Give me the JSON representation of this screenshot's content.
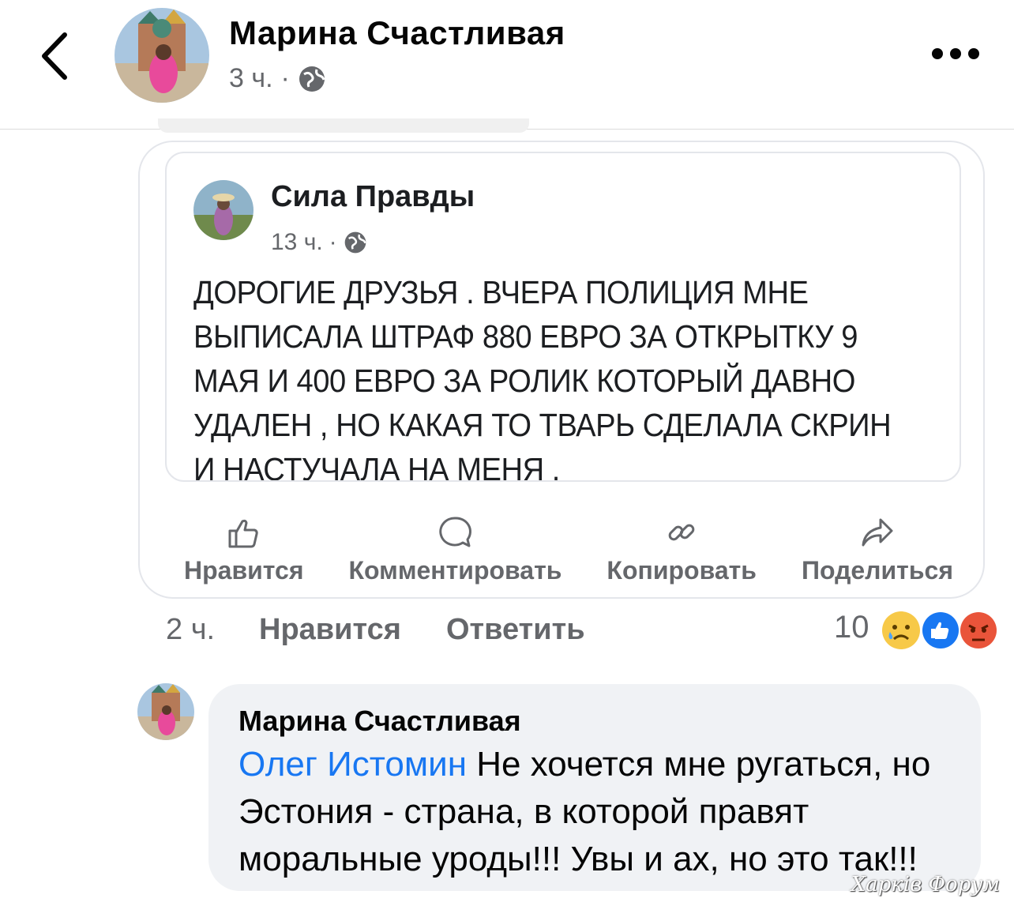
{
  "header": {
    "author_name": "Марина Счастливая",
    "time": "3 ч.",
    "separator": "·",
    "back_icon": "chevron-left-icon",
    "more_icon": "more-horizontal-icon",
    "privacy_icon": "globe-icon"
  },
  "shared_post": {
    "author_name": "Сила Правды",
    "time": "13 ч.",
    "separator": "·",
    "text": "ДОРОГИЕ ДРУЗЬЯ . ВЧЕРА ПОЛИЦИЯ МНЕ ВЫПИСАЛА ШТРАФ 880 ЕВРО ЗА ОТКРЫТКУ 9 МАЯ И 400 ЕВРО  ЗА РОЛИК КОТОРЫЙ ДАВНО УДАЛЕН , НО КАКАЯ ТО ТВАРЬ СДЕЛАЛА СКРИН И НАСТУЧАЛА НА МЕНЯ .",
    "actions": [
      {
        "label": "Нравится",
        "icon": "thumbs-up-icon"
      },
      {
        "label": "Комментировать",
        "icon": "comment-icon"
      },
      {
        "label": "Копировать",
        "icon": "link-icon"
      },
      {
        "label": "Поделиться",
        "icon": "share-icon"
      }
    ]
  },
  "comment_footer": {
    "time": "2 ч.",
    "like_label": "Нравится",
    "reply_label": "Ответить",
    "reaction_count": "10",
    "reactions": [
      "sad-reaction-icon",
      "like-reaction-icon",
      "angry-reaction-icon"
    ]
  },
  "reply": {
    "author_name": "Марина Счастливая",
    "mention": "Олег Истомин",
    "text": " Не хочется мне ругаться, но Эстония - страна,  в которой правят моральные уроды!!! Увы и ах, но это так!!!"
  },
  "watermark": "Харків Форум",
  "colors": {
    "link": "#1877f2",
    "secondary_text": "#65676b",
    "bubble": "#f0f2f5",
    "like_blue": "#1877f2",
    "angry_orange": "#e9543a",
    "sad_yellow": "#f7c948"
  }
}
